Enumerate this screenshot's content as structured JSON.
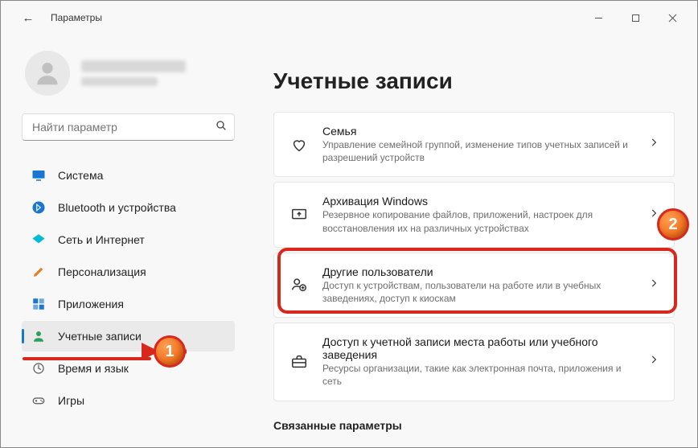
{
  "titlebar": {
    "back_glyph": "←",
    "title": "Параметры"
  },
  "search": {
    "placeholder": "Найти параметр"
  },
  "sidebar": {
    "items": [
      {
        "label": "Система"
      },
      {
        "label": "Bluetooth и устройства"
      },
      {
        "label": "Сеть и Интернет"
      },
      {
        "label": "Персонализация"
      },
      {
        "label": "Приложения"
      },
      {
        "label": "Учетные записи"
      },
      {
        "label": "Время и язык"
      },
      {
        "label": "Игры"
      }
    ]
  },
  "main": {
    "title": "Учетные записи",
    "cards": [
      {
        "title": "Семья",
        "desc": "Управление семейной группой, изменение типов учетных записей и разрешений устройств"
      },
      {
        "title": "Архивация Windows",
        "desc": "Резервное копирование файлов, приложений, настроек для восстановления их на различных устройствах"
      },
      {
        "title": "Другие пользователи",
        "desc": "Доступ к устройствам, пользователи на работе или в учебных заведениях, доступ к киоскам"
      },
      {
        "title": "Доступ к учетной записи места работы или учебного заведения",
        "desc": "Ресурсы организации, такие как электронная почта, приложения и сеть"
      }
    ],
    "subheading": "Связанные параметры"
  },
  "annotations": {
    "badge1": "1",
    "badge2": "2"
  }
}
